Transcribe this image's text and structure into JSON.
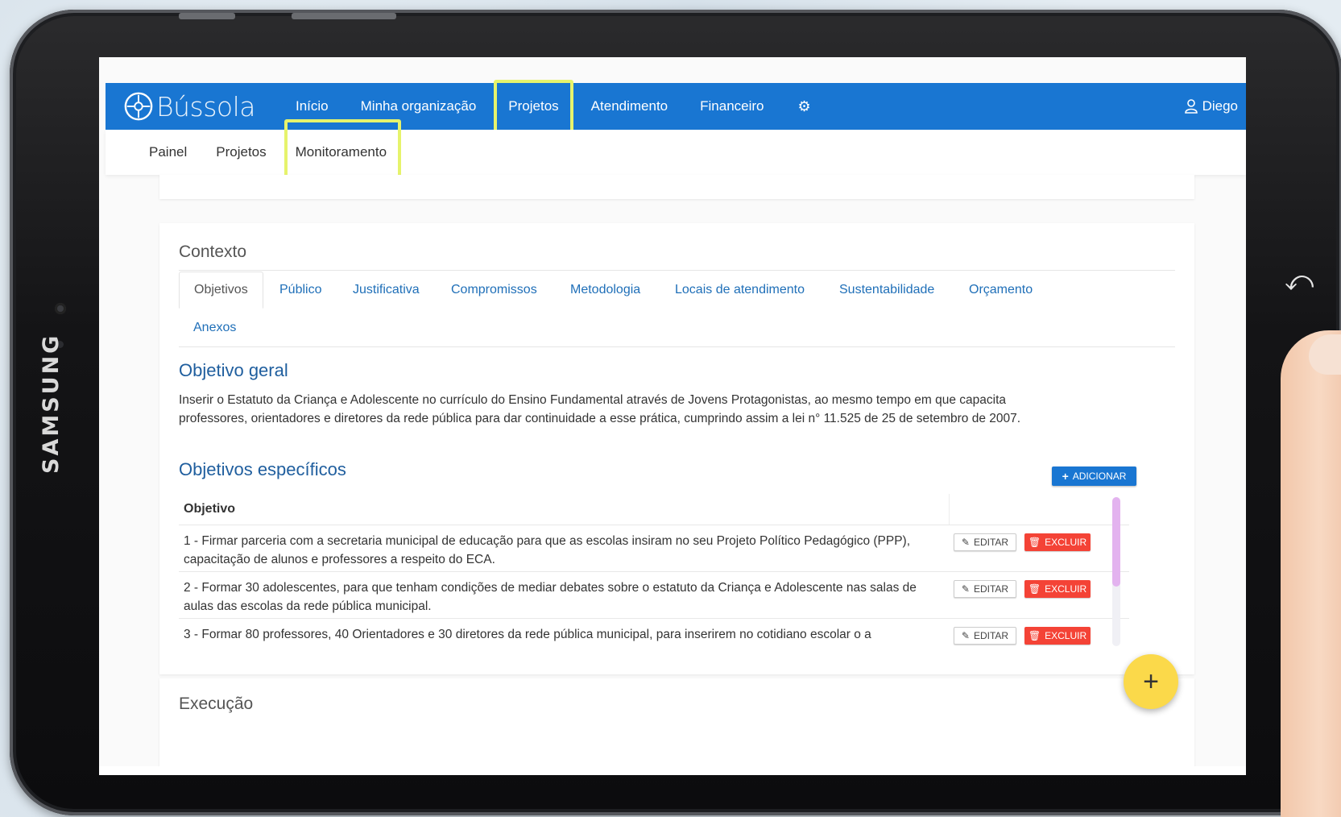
{
  "device": {
    "brand": "SAMSUNG"
  },
  "app": {
    "logo_text": "Bússola"
  },
  "navbar": {
    "items": [
      {
        "label": "Início"
      },
      {
        "label": "Minha organização"
      },
      {
        "label": "Projetos"
      },
      {
        "label": "Atendimento"
      },
      {
        "label": "Financeiro"
      }
    ],
    "user": "Diego"
  },
  "subnav": {
    "items": [
      {
        "label": "Painel"
      },
      {
        "label": "Projetos"
      },
      {
        "label": "Monitoramento"
      }
    ]
  },
  "context": {
    "title": "Contexto",
    "tabs": [
      {
        "label": "Objetivos"
      },
      {
        "label": "Público"
      },
      {
        "label": "Justificativa"
      },
      {
        "label": "Compromissos"
      },
      {
        "label": "Metodologia"
      },
      {
        "label": "Locais de atendimento"
      },
      {
        "label": "Sustentabilidade"
      },
      {
        "label": "Orçamento"
      },
      {
        "label": "Anexos"
      }
    ],
    "general_title": "Objetivo geral",
    "general_text": "Inserir o Estatuto da Criança e Adolescente no currículo do Ensino Fundamental através de Jovens Protagonistas, ao mesmo tempo em que capacita professores, orientadores e diretores da rede pública para dar continuidade a esse prática, cumprindo assim a lei n° 11.525 de 25 de setembro de 2007.",
    "specific_title": "Objetivos específicos",
    "add_label": "ADICIONAR",
    "table_header": "Objetivo",
    "edit_label": "EDITAR",
    "delete_label": "EXCLUIR",
    "rows": [
      {
        "text": "1 - Firmar parceria com a secretaria municipal de educação para que as escolas insiram no seu Projeto Político Pedagógico (PPP), capacitação de alunos e professores a respeito do ECA."
      },
      {
        "text": "2 - Formar 30 adolescentes, para que tenham condições de mediar debates sobre o estatuto da Criança e Adolescente nas salas de aulas das escolas da rede pública municipal."
      },
      {
        "text": "3 - Formar 80 professores, 40 Orientadores e 30 diretores da rede pública municipal, para inserirem no cotidiano escolar o a"
      }
    ],
    "scroll_fraction": 0.6
  },
  "execution": {
    "title": "Execução"
  },
  "fab": {
    "label": "+"
  },
  "colors": {
    "primary": "#1976d2",
    "highlight": "#e6f36c",
    "danger": "#f44336",
    "fab": "#fbd94a"
  }
}
